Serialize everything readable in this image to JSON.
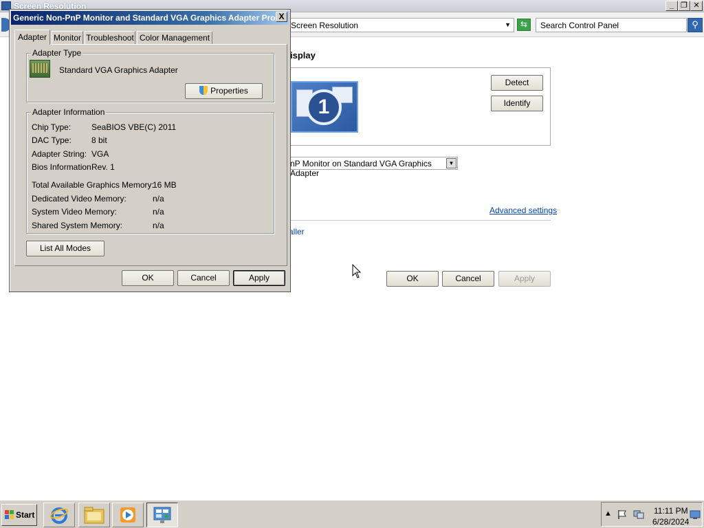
{
  "background_window": {
    "title": "Screen Resolution",
    "address": "Screen Resolution",
    "search_placeholder": "Search Control Panel",
    "heading": "isplay",
    "detect": "Detect",
    "identify": "Identify",
    "monitor_number": "1",
    "display_select": "nP Monitor on Standard VGA Graphics Adapter",
    "advanced_settings": "Advanced settings",
    "smaller_link": "aller",
    "ok": "OK",
    "cancel": "Cancel",
    "apply": "Apply"
  },
  "dialog": {
    "title": "Generic Non-PnP Monitor and Standard VGA Graphics Adapter Pro...",
    "close": "X",
    "tabs": [
      "Adapter",
      "Monitor",
      "Troubleshoot",
      "Color Management"
    ],
    "adapter_type": {
      "label": "Adapter Type",
      "name": "Standard VGA Graphics Adapter",
      "properties_button": "Properties"
    },
    "adapter_info": {
      "label": "Adapter Information",
      "chip_type_label": "Chip Type:",
      "chip_type_value": "SeaBIOS VBE(C) 2011",
      "dac_type_label": "DAC Type:",
      "dac_type_value": "8 bit",
      "adapter_string_label": "Adapter String:",
      "adapter_string_value": "VGA",
      "bios_info_label": "Bios Information:",
      "bios_info_value": "Rev. 1",
      "total_mem_label": "Total Available Graphics Memory:",
      "total_mem_value": "16 MB",
      "dedicated_mem_label": "Dedicated Video Memory:",
      "dedicated_mem_value": "n/a",
      "system_mem_label": "System Video Memory:",
      "system_mem_value": "n/a",
      "shared_mem_label": "Shared System Memory:",
      "shared_mem_value": "n/a"
    },
    "list_all_modes": "List All Modes",
    "ok": "OK",
    "cancel": "Cancel",
    "apply": "Apply"
  },
  "taskbar": {
    "start": "Start",
    "time": "11:11 PM",
    "date": "6/28/2024"
  }
}
